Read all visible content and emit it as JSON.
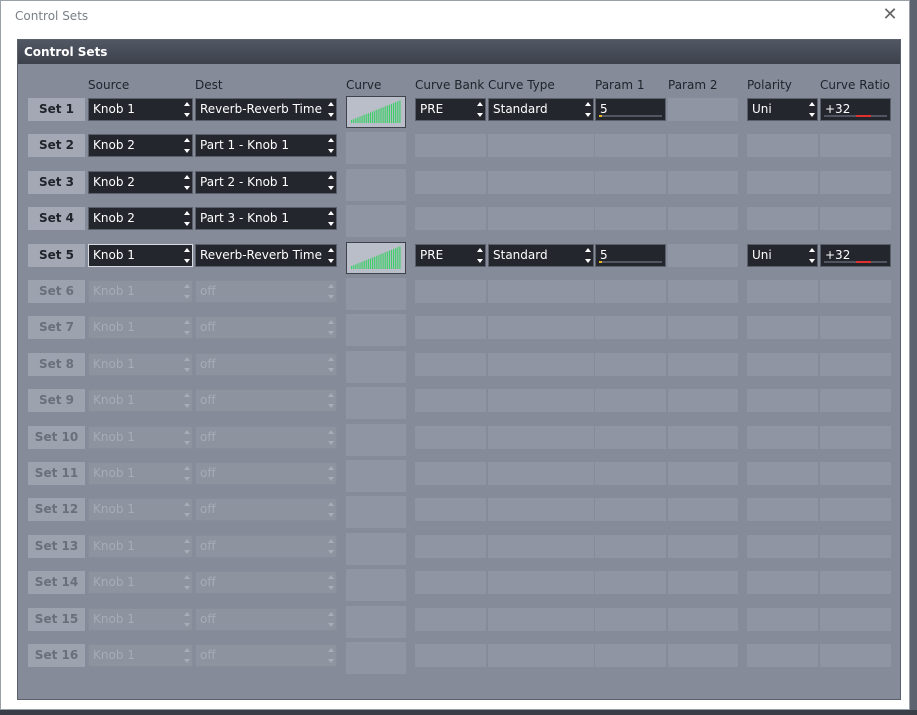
{
  "window": {
    "title": "Control Sets"
  },
  "panel": {
    "title": "Control Sets"
  },
  "columns": {
    "source": "Source",
    "dest": "Dest",
    "curve": "Curve",
    "curve_bank": "Curve Bank",
    "curve_type": "Curve Type",
    "param1": "Param 1",
    "param2": "Param 2",
    "polarity": "Polarity",
    "curve_ratio": "Curve Ratio"
  },
  "colors": {
    "param_fill": "#e6b422",
    "ratio_fill": "#e03030",
    "curve_bars": "#3fcf6a"
  },
  "rows": [
    {
      "label": "Set 1",
      "source": "Knob 1",
      "dest": "Reverb-Reverb Time",
      "active": true,
      "has_curve": true,
      "curve_bank": "PRE",
      "curve_type": "Standard",
      "param1": "5",
      "param1_level": 0.05,
      "polarity": "Uni",
      "curve_ratio": "+32",
      "curve_ratio_level": 0.75,
      "focused": false
    },
    {
      "label": "Set 2",
      "source": "Knob 2",
      "dest": "Part 1 - Knob 1",
      "active": true,
      "has_curve": false
    },
    {
      "label": "Set 3",
      "source": "Knob 2",
      "dest": "Part 2 - Knob 1",
      "active": true,
      "has_curve": false
    },
    {
      "label": "Set 4",
      "source": "Knob 2",
      "dest": "Part 3 - Knob 1",
      "active": true,
      "has_curve": false
    },
    {
      "label": "Set 5",
      "source": "Knob 1",
      "dest": "Reverb-Reverb Time",
      "active": true,
      "has_curve": true,
      "curve_bank": "PRE",
      "curve_type": "Standard",
      "param1": "5",
      "param1_level": 0.05,
      "polarity": "Uni",
      "curve_ratio": "+32",
      "curve_ratio_level": 0.75,
      "focused": true
    },
    {
      "label": "Set 6",
      "source": "Knob 1",
      "dest": "off",
      "active": false,
      "has_curve": false
    },
    {
      "label": "Set 7",
      "source": "Knob 1",
      "dest": "off",
      "active": false,
      "has_curve": false
    },
    {
      "label": "Set 8",
      "source": "Knob 1",
      "dest": "off",
      "active": false,
      "has_curve": false
    },
    {
      "label": "Set 9",
      "source": "Knob 1",
      "dest": "off",
      "active": false,
      "has_curve": false
    },
    {
      "label": "Set 10",
      "source": "Knob 1",
      "dest": "off",
      "active": false,
      "has_curve": false
    },
    {
      "label": "Set 11",
      "source": "Knob 1",
      "dest": "off",
      "active": false,
      "has_curve": false
    },
    {
      "label": "Set 12",
      "source": "Knob 1",
      "dest": "off",
      "active": false,
      "has_curve": false
    },
    {
      "label": "Set 13",
      "source": "Knob 1",
      "dest": "off",
      "active": false,
      "has_curve": false
    },
    {
      "label": "Set 14",
      "source": "Knob 1",
      "dest": "off",
      "active": false,
      "has_curve": false
    },
    {
      "label": "Set 15",
      "source": "Knob 1",
      "dest": "off",
      "active": false,
      "has_curve": false
    },
    {
      "label": "Set 16",
      "source": "Knob 1",
      "dest": "off",
      "active": false,
      "has_curve": false
    }
  ]
}
